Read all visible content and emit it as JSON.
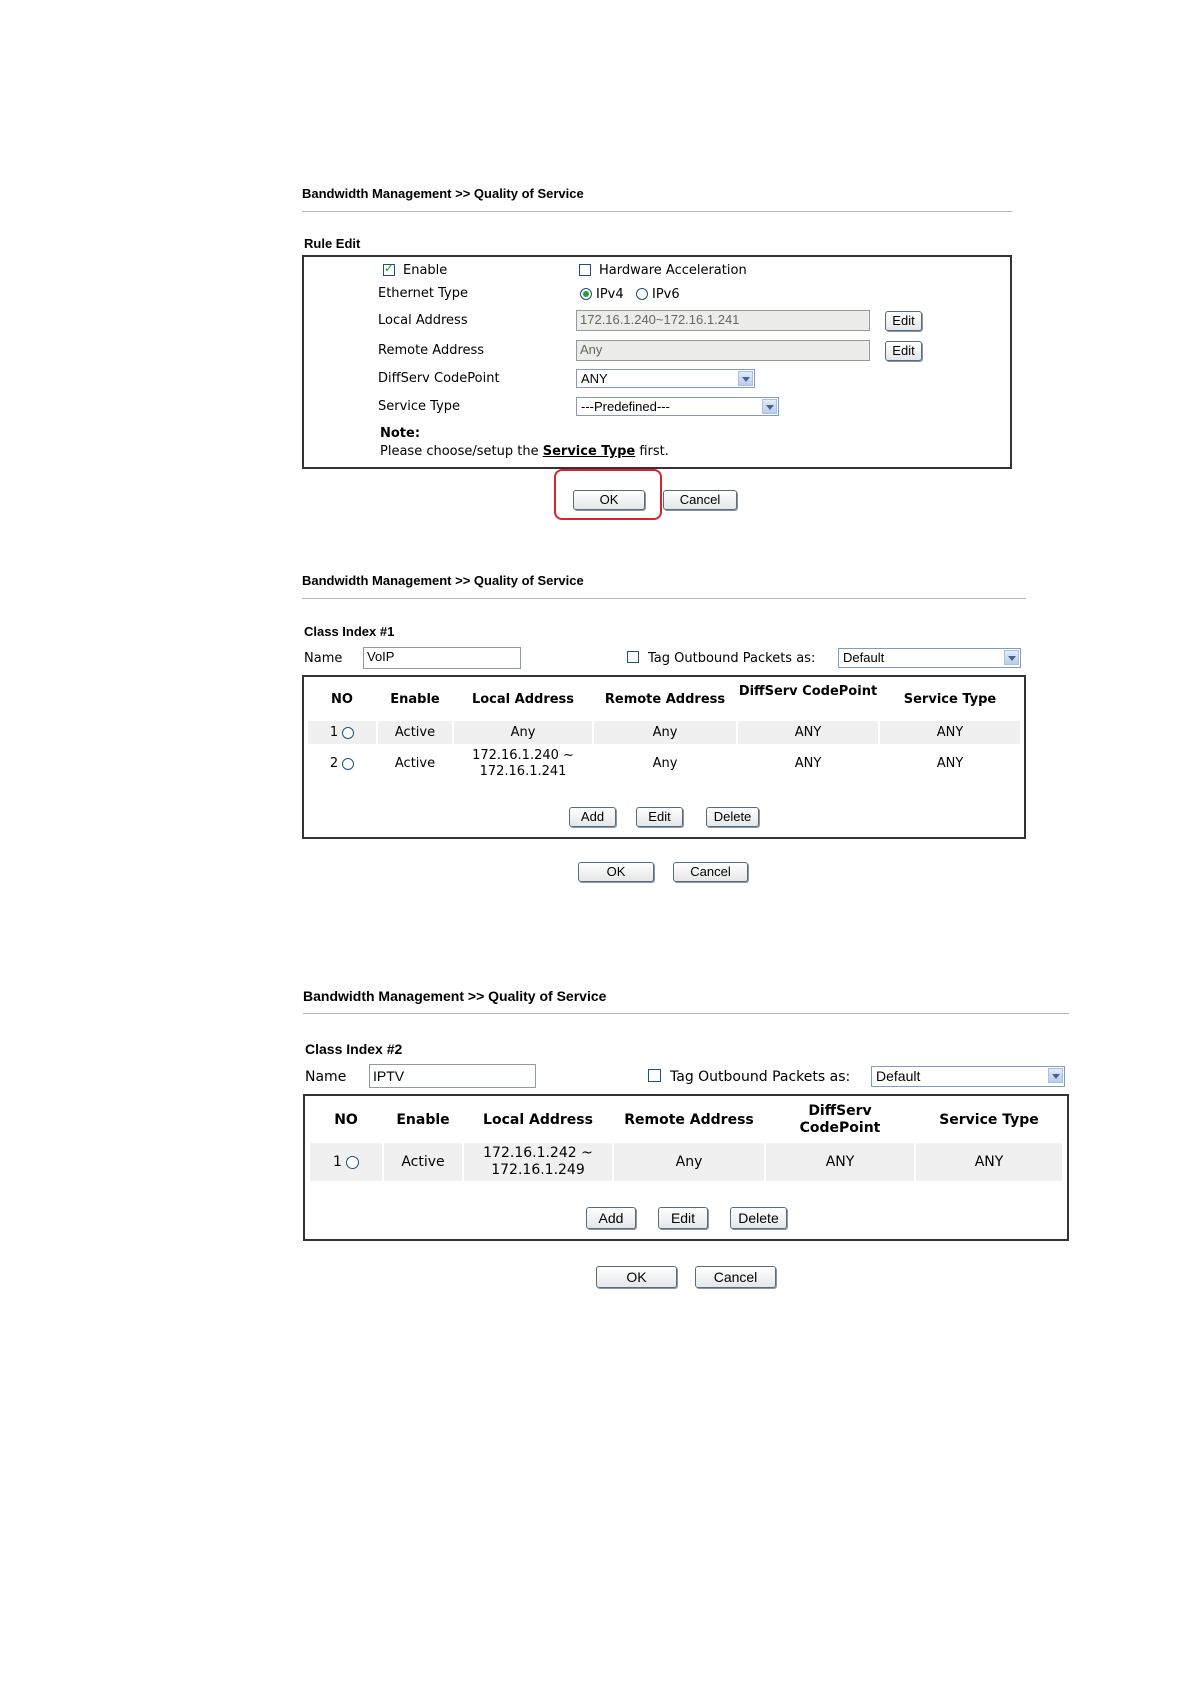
{
  "section1": {
    "breadcrumb": "Bandwidth Management >> Quality of Service",
    "heading": "Rule Edit",
    "enable_label": "Enable",
    "enable_checked": true,
    "hw_accel_label": "Hardware Acceleration",
    "hw_accel_checked": false,
    "ethernet_type_label": "Ethernet Type",
    "ipv4_label": "IPv4",
    "ipv6_label": "IPv6",
    "ethernet_type_selected": "IPv4",
    "local_address_label": "Local Address",
    "local_address_value": "172.16.1.240~172.16.1.241",
    "remote_address_label": "Remote Address",
    "remote_address_value": "Any",
    "edit_label": "Edit",
    "diffserv_label": "DiffServ CodePoint",
    "diffserv_value": "ANY",
    "service_type_label": "Service Type",
    "service_type_value": "---Predefined---",
    "note_title": "Note:",
    "note_prefix": "Please choose/setup the ",
    "note_link": "Service Type",
    "note_suffix": " first.",
    "ok_label": "OK",
    "cancel_label": "Cancel"
  },
  "section2": {
    "breadcrumb": "Bandwidth Management >> Quality of Service",
    "class_index": "Class Index #1",
    "name_label": "Name",
    "name_value": "VoIP",
    "tag_label": "Tag Outbound Packets as:",
    "tag_checked": false,
    "tag_value": "Default",
    "headers": [
      "NO",
      "Enable",
      "Local Address",
      "Remote Address",
      "DiffServ CodePoint",
      "Service Type"
    ],
    "rows": [
      {
        "no": "1",
        "enable": "Active",
        "local_1": "Any",
        "local_2": "",
        "remote": "Any",
        "diffserv": "ANY",
        "service": "ANY"
      },
      {
        "no": "2",
        "enable": "Active",
        "local_1": "172.16.1.240 ~",
        "local_2": "172.16.1.241",
        "remote": "Any",
        "diffserv": "ANY",
        "service": "ANY"
      }
    ],
    "add_label": "Add",
    "edit_label": "Edit",
    "delete_label": "Delete",
    "ok_label": "OK",
    "cancel_label": "Cancel"
  },
  "section3": {
    "breadcrumb": "Bandwidth Management >> Quality of Service",
    "class_index": "Class Index #2",
    "name_label": "Name",
    "name_value": "IPTV",
    "tag_label": "Tag Outbound Packets as:",
    "tag_checked": false,
    "tag_value": "Default",
    "headers": [
      "NO",
      "Enable",
      "Local Address",
      "Remote Address",
      "DiffServ CodePoint",
      "Service Type"
    ],
    "rows": [
      {
        "no": "1",
        "enable": "Active",
        "local_1": "172.16.1.242 ~",
        "local_2": "172.16.1.249",
        "remote": "Any",
        "diffserv": "ANY",
        "service": "ANY"
      }
    ],
    "add_label": "Add",
    "edit_label": "Edit",
    "delete_label": "Delete",
    "ok_label": "OK",
    "cancel_label": "Cancel"
  },
  "colors": {
    "highlight": "#d8232a",
    "radio_checked": "#21a121",
    "row_shade": "#f0f0f0"
  }
}
